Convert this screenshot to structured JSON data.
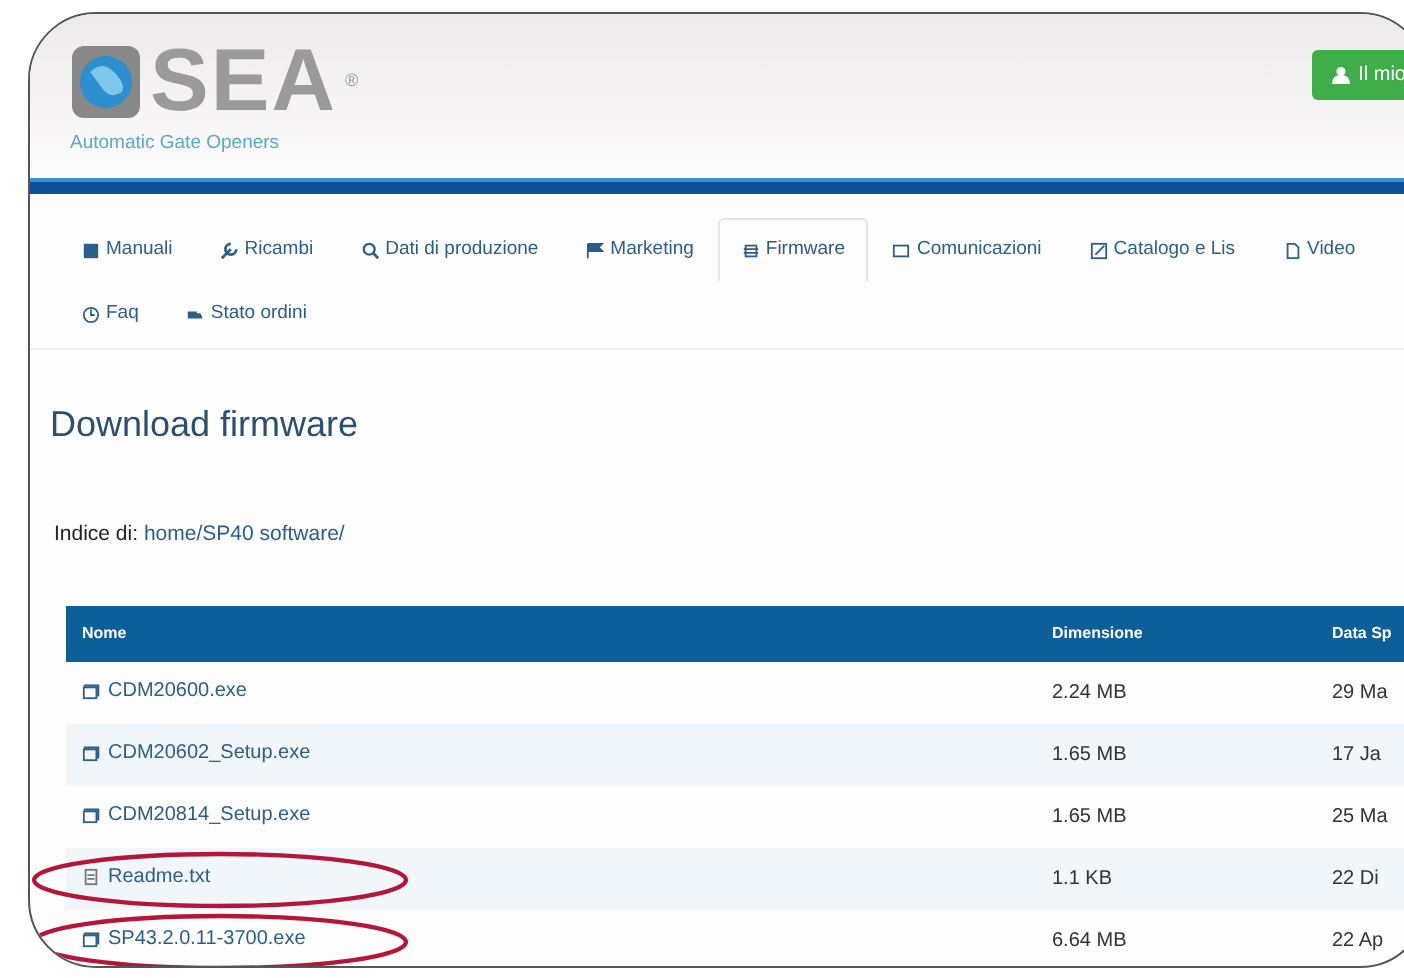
{
  "header": {
    "logo": "SEA",
    "registered": "®",
    "tagline": "Automatic Gate Openers",
    "account_button": "Il mio"
  },
  "tabs": [
    {
      "label": "Manuali",
      "selected": false
    },
    {
      "label": "Ricambi",
      "selected": false
    },
    {
      "label": "Dati di produzione",
      "selected": false
    },
    {
      "label": "Marketing",
      "selected": false
    },
    {
      "label": "Firmware",
      "selected": true
    },
    {
      "label": "Comunicazioni",
      "selected": false
    },
    {
      "label": "Catalogo e Lis",
      "selected": false
    },
    {
      "label": "Video",
      "selected": false
    },
    {
      "label": "Faq",
      "selected": false
    },
    {
      "label": "Stato ordini",
      "selected": false
    }
  ],
  "title": "Download firmware",
  "index": {
    "label": "Indice di:",
    "path": "home/SP40 software/"
  },
  "table": {
    "columns": [
      "Nome",
      "Dimensione",
      "Data Sp"
    ],
    "rows": [
      {
        "name": "CDM20600.exe",
        "size": "2.24 MB",
        "date": "29 Ma",
        "kind": "exe",
        "highlighted": false
      },
      {
        "name": "CDM20602_Setup.exe",
        "size": "1.65 MB",
        "date": "17 Ja",
        "kind": "exe",
        "highlighted": false
      },
      {
        "name": "CDM20814_Setup.exe",
        "size": "1.65 MB",
        "date": "25 Ma",
        "kind": "exe",
        "highlighted": false
      },
      {
        "name": "Readme.txt",
        "size": "1.1 KB",
        "date": "22 Di",
        "kind": "text",
        "highlighted": true
      },
      {
        "name": "SP43.2.0.11-3700.exe",
        "size": "6.64 MB",
        "date": "22 Ap",
        "kind": "exe",
        "highlighted": true
      }
    ]
  }
}
